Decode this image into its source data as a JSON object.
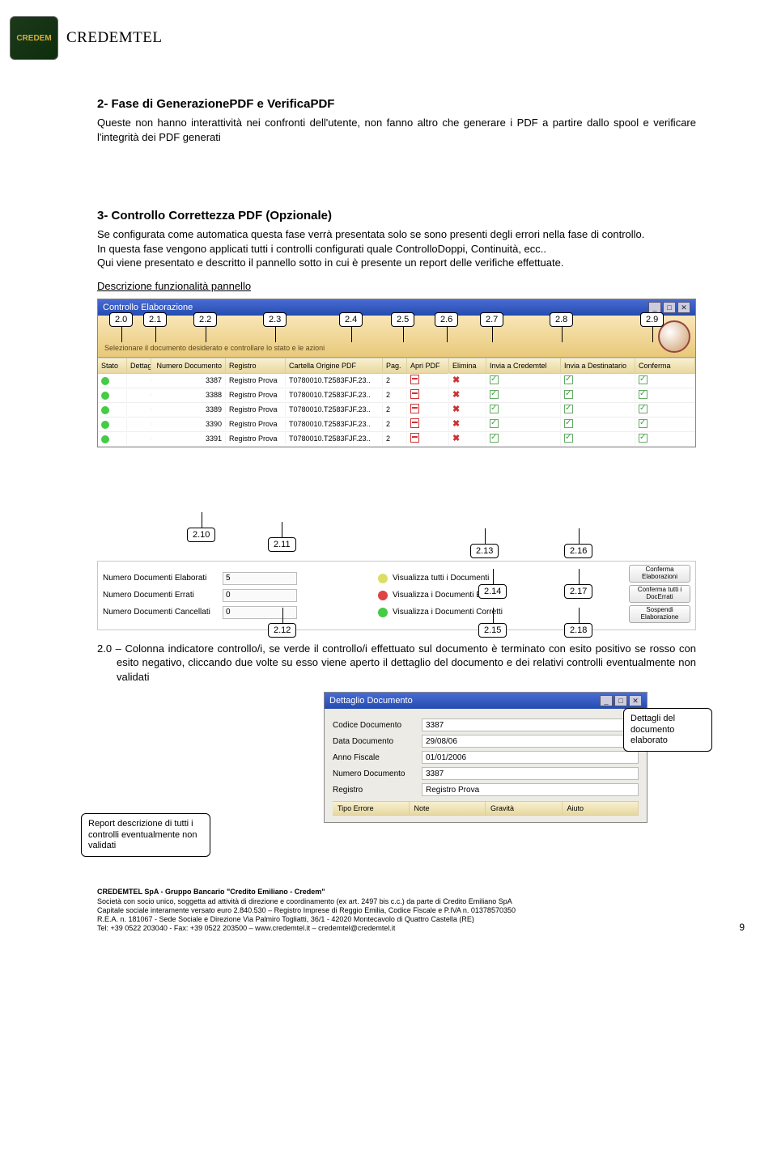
{
  "header": {
    "logo_badge": "CREDEM",
    "logo_text": "CREDEMTEL"
  },
  "section1": {
    "title": "2- Fase di GenerazionePDF e VerificaPDF",
    "body": "Queste non hanno interattività nei confronti dell'utente, non fanno altro che generare i PDF a partire dallo spool e verificare l'integrità dei PDF generati"
  },
  "section2": {
    "title": "3- Controllo Correttezza PDF (Opzionale)",
    "body1": "Se configurata come automatica questa fase verrà presentata solo se sono presenti degli errori nella fase di controllo.",
    "body2": "In questa fase vengono applicati tutti i controlli configurati quale ControlloDoppi, Continuità, ecc..",
    "body3": "Qui viene presentato e descritto il pannello sotto in cui è presente un report delle verifiche effettuate.",
    "subhead": "Descrizione funzionalità pannello"
  },
  "win1": {
    "title": "Controllo Elaborazione",
    "hint": "Selezionare il documento desiderato e controllare lo stato e le azioni",
    "cols": [
      "Stato",
      "Dettagli",
      "Numero Documento",
      "Registro",
      "Cartella Origine PDF",
      "Pag.",
      "Apri PDF",
      "Elimina",
      "Invia a Credemtel",
      "Invia a Destinatario",
      "Conferma"
    ],
    "rows": [
      {
        "num": "3387",
        "reg": "Registro Prova",
        "cart": "T0780010.T2583FJF.23..",
        "pag": "2"
      },
      {
        "num": "3388",
        "reg": "Registro Prova",
        "cart": "T0780010.T2583FJF.23..",
        "pag": "2"
      },
      {
        "num": "3389",
        "reg": "Registro Prova",
        "cart": "T0780010.T2583FJF.23..",
        "pag": "2"
      },
      {
        "num": "3390",
        "reg": "Registro Prova",
        "cart": "T0780010.T2583FJF.23..",
        "pag": "2"
      },
      {
        "num": "3391",
        "reg": "Registro Prova",
        "cart": "T0780010.T2583FJF.23..",
        "pag": "2"
      }
    ],
    "callouts_top": [
      "2.0",
      "2.1",
      "2.2",
      "2.3",
      "2.4",
      "2.5",
      "2.6",
      "2.7",
      "2.8",
      "2.9"
    ],
    "strip": {
      "l1": "Numero Documenti Elaborati",
      "v1": "5",
      "l2": "Numero Documenti Errati",
      "v2": "0",
      "l3": "Numero Documenti Cancellati",
      "v3": "0",
      "m1": "Visualizza tutti i Documenti",
      "m2": "Visualizza i Documenti Errati",
      "m3": "Visualizza i Documenti Corretti",
      "b1": "Conferma Elaborazioni",
      "b2": "Conferma tutti i DocErrati",
      "b3": "Sospendi Elaborazione"
    },
    "callouts_bottom": {
      "c10": "2.10",
      "c11": "2.11",
      "c12": "2.12",
      "c13": "2.13",
      "c14": "2.14",
      "c15": "2.15",
      "c16": "2.16",
      "c17": "2.17",
      "c18": "2.18"
    }
  },
  "item20": "2.0 – Colonna indicatore controllo/i, se verde il controllo/i effettuato sul documento è terminato con esito positivo se rosso con esito negativo, cliccando due volte su esso viene aperto il dettaglio del documento e dei relativi controlli eventualmente non validati",
  "win2": {
    "title": "Dettaglio Documento",
    "f1": "Codice Documento",
    "v1": "3387",
    "f2": "Data Documento",
    "v2": "29/08/06",
    "f3": "Anno Fiscale",
    "v3": "01/01/2006",
    "f4": "Numero Documento",
    "v4": "3387",
    "f5": "Registro",
    "v5": "Registro Prova",
    "sub": [
      "Tipo Errore",
      "Note",
      "Gravità",
      "Aiuto"
    ]
  },
  "speech_right": "Dettagli del documento elaborato",
  "speech_left": "Report descrizione di tutti i controlli eventualmente non validati",
  "footer": {
    "l1": "CREDEMTEL SpA - Gruppo Bancario \"Credito Emiliano - Credem\"",
    "l2": "Società con socio unico, soggetta ad attività di direzione e coordinamento (ex art. 2497 bis c.c.) da parte di Credito Emiliano SpA",
    "l3": "Capitale sociale interamente versato euro 2.840.530 – Registro Imprese di Reggio Emilia, Codice Fiscale e P.IVA n. 01378570350",
    "l4": "R.E.A. n. 181067 - Sede Sociale e Direzione Via Palmiro Togliatti, 36/1 - 42020 Montecavolo di Quattro Castella (RE)",
    "l5": "Tel: +39 0522 203040 - Fax: +39 0522 203500 – www.credemtel.it – credemtel@credemtel.it",
    "page": "9"
  }
}
